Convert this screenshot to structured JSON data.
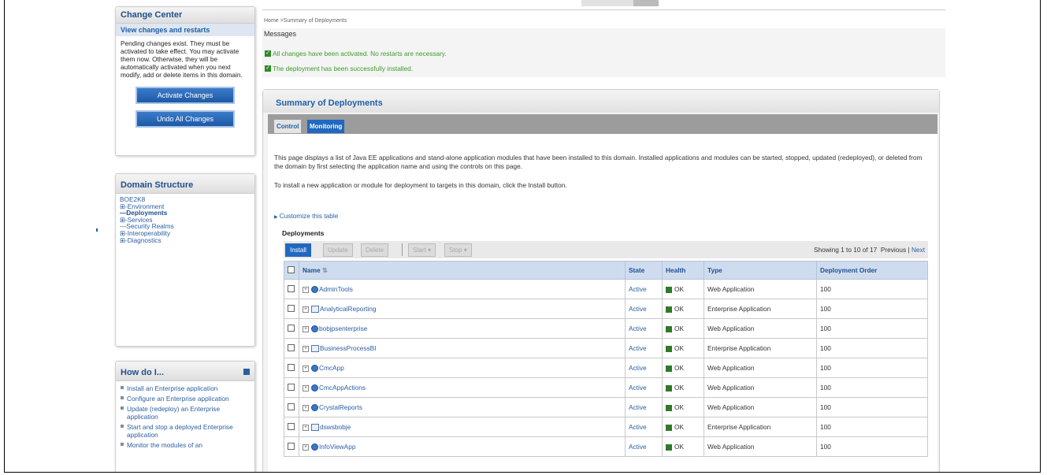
{
  "change_center": {
    "title": "Change Center",
    "link": "View changes and restarts",
    "text": "Pending changes exist. They must be activated to take effect. You may activate them now. Otherwise, they will be automatically activated when you next modify, add or delete items in this domain.",
    "activate_label": "Activate Changes",
    "undo_label": "Undo All Changes"
  },
  "domain_structure": {
    "title": "Domain Structure",
    "root": "BOE2K8",
    "items": [
      {
        "prefix": "⊞-",
        "label": "Environment"
      },
      {
        "prefix": "—",
        "label": "Deployments"
      },
      {
        "prefix": "⊞-",
        "label": "Services"
      },
      {
        "prefix": "—",
        "label": "Security Realms"
      },
      {
        "prefix": "⊞-",
        "label": "Interoperability"
      },
      {
        "prefix": "⊞-",
        "label": "Diagnostics"
      }
    ]
  },
  "howto": {
    "title": "How do I...",
    "items": [
      "Install an Enterprise application",
      "Configure an Enterprise application",
      "Update (redeploy) an Enterprise application",
      "Start and stop a deployed Enterprise application",
      "Monitor the modules of an"
    ]
  },
  "breadcrumb": "Home >Summary of Deployments",
  "messages": {
    "title": "Messages",
    "items": [
      "All changes have been activated. No restarts are necessary.",
      "The deployment has been successfully installed."
    ]
  },
  "summary": {
    "title": "Summary of Deployments",
    "tabs": [
      "Control",
      "Monitoring"
    ],
    "desc1": "This page displays a list of Java EE applications and stand-alone application modules that have been installed to this domain. Installed applications and modules can be started, stopped, updated (redeployed), or deleted from the domain by first selecting the application name and using the controls on this page.",
    "desc2": "To install a new application or module for deployment to targets in this domain, click the Install button.",
    "customize": "Customize this table",
    "deployments_label": "Deployments",
    "toolbar": {
      "install": "Install",
      "update": "Update",
      "delete": "Delete",
      "start": "Start",
      "stop": "Stop"
    },
    "showing": "Showing 1 to 10 of 17",
    "previous": "Previous",
    "sep": "|",
    "next": "Next",
    "columns": [
      "Name",
      "State",
      "Health",
      "Type",
      "Deployment Order"
    ],
    "rows": [
      {
        "name": "AdminTools",
        "kind": "app",
        "state": "Active",
        "health": "OK",
        "type": "Web Application",
        "order": "100"
      },
      {
        "name": "AnalyticalReporting",
        "kind": "ent",
        "state": "Active",
        "health": "OK",
        "type": "Enterprise Application",
        "order": "100"
      },
      {
        "name": "bobjpsenterprise",
        "kind": "app",
        "state": "Active",
        "health": "OK",
        "type": "Web Application",
        "order": "100"
      },
      {
        "name": "BusinessProcessBI",
        "kind": "ent",
        "state": "Active",
        "health": "OK",
        "type": "Enterprise Application",
        "order": "100"
      },
      {
        "name": "CmcApp",
        "kind": "app",
        "state": "Active",
        "health": "OK",
        "type": "Web Application",
        "order": "100"
      },
      {
        "name": "CmcAppActions",
        "kind": "app",
        "state": "Active",
        "health": "OK",
        "type": "Web Application",
        "order": "100"
      },
      {
        "name": "CrystalReports",
        "kind": "app",
        "state": "Active",
        "health": "OK",
        "type": "Web Application",
        "order": "100"
      },
      {
        "name": "dswsbobje",
        "kind": "ent",
        "state": "Active",
        "health": "OK",
        "type": "Enterprise Application",
        "order": "100"
      },
      {
        "name": "InfoViewApp",
        "kind": "app",
        "state": "Active",
        "health": "OK",
        "type": "Web Application",
        "order": "100"
      }
    ]
  }
}
